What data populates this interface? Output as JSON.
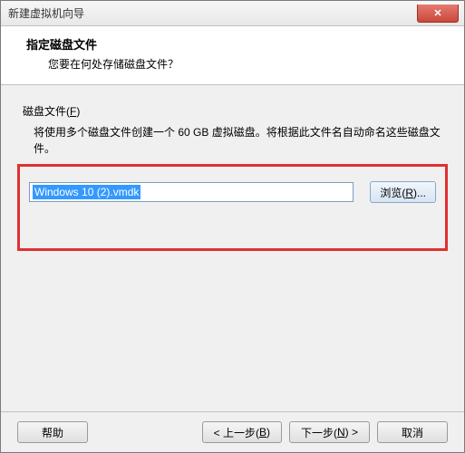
{
  "window": {
    "title": "新建虚拟机向导"
  },
  "header": {
    "title": "指定磁盘文件",
    "subtitle": "您要在何处存储磁盘文件？"
  },
  "section": {
    "label": "磁盘文件(F)",
    "description": "将使用多个磁盘文件创建一个 60 GB 虚拟磁盘。将根据此文件名自动命名这些磁盘文件。"
  },
  "input": {
    "value": "Windows 10 (2).vmdk"
  },
  "buttons": {
    "browse": "浏览(R)...",
    "help": "帮助",
    "back": "< 上一步(B)",
    "next": "下一步(N) >",
    "cancel": "取消"
  }
}
